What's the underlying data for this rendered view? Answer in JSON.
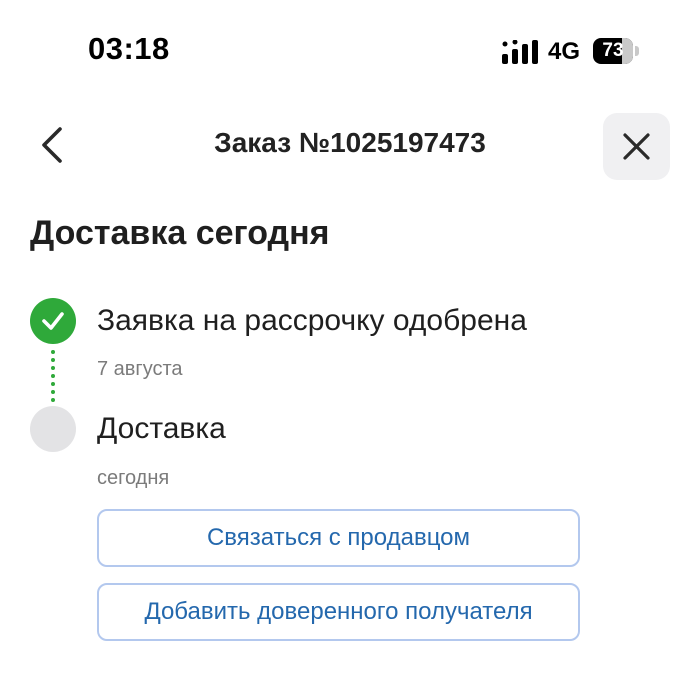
{
  "status_bar": {
    "time": "03:18",
    "network": "4G",
    "battery_level": "73",
    "signal_icon": "signal-bars-icon"
  },
  "header": {
    "back_icon": "chevron-left-icon",
    "title": "Заказ №1025197473",
    "close_icon": "close-icon"
  },
  "delivery": {
    "heading": "Доставка сегодня",
    "steps": [
      {
        "title": "Заявка на рассрочку одобрена",
        "date": "7 августа",
        "status": "done",
        "icon": "checkmark-icon"
      },
      {
        "title": "Доставка",
        "date": "сегодня",
        "status": "pending"
      }
    ],
    "actions": {
      "contact_seller": "Связаться с продавцом",
      "add_recipient": "Добавить доверенного получателя"
    }
  },
  "colors": {
    "accent_green": "#2fa93a",
    "button_text": "#2468ad",
    "button_border": "#b3c8ee",
    "pending_circle": "#e3e3e5"
  }
}
